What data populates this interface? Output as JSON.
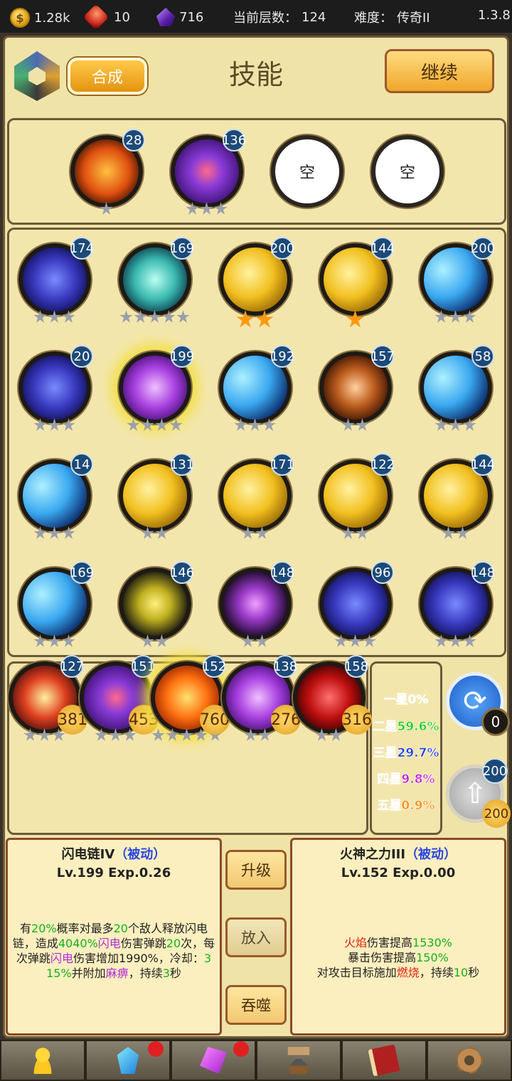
{
  "topbar": {
    "gold": "1.28k",
    "red_gem": "10",
    "crystal": "716",
    "floor_label": "当前层数：",
    "floor": "124",
    "difficulty_label": "难度：",
    "difficulty": "传奇II",
    "version": "1.3.8"
  },
  "header": {
    "merge": "合成",
    "title": "技能",
    "continue": "继续"
  },
  "equipped": [
    {
      "level": "28",
      "stars": 1,
      "color": "orange"
    },
    {
      "level": "136",
      "stars": 3,
      "color": "purple"
    },
    {
      "empty": "空"
    },
    {
      "empty": "空"
    }
  ],
  "grid": [
    [
      {
        "level": "174",
        "stars": 3,
        "color": "navy"
      },
      {
        "level": "169",
        "stars": 5,
        "color": "teal"
      },
      {
        "level": "200",
        "stars": 2,
        "gold_stars": true,
        "color": "gold"
      },
      {
        "level": "144",
        "stars": 1,
        "gold_stars": true,
        "color": "gold"
      },
      {
        "level": "200",
        "stars": 3,
        "color": "sky"
      }
    ],
    [
      {
        "level": "20",
        "stars": 3,
        "color": "navy"
      },
      {
        "level": "199",
        "stars": 4,
        "color": "violet",
        "selected": true
      },
      {
        "level": "192",
        "stars": 3,
        "color": "sky"
      },
      {
        "level": "157",
        "stars": 2,
        "color": "brown"
      },
      {
        "level": "58",
        "stars": 3,
        "color": "sky"
      }
    ],
    [
      {
        "level": "14",
        "stars": 3,
        "color": "sky"
      },
      {
        "level": "131",
        "stars": 2,
        "color": "gold"
      },
      {
        "level": "171",
        "stars": 2,
        "color": "gold"
      },
      {
        "level": "122",
        "stars": 2,
        "color": "gold"
      },
      {
        "level": "144",
        "stars": 2,
        "color": "gold"
      }
    ],
    [
      {
        "level": "169",
        "stars": 3,
        "color": "sky"
      },
      {
        "level": "146",
        "stars": 2,
        "color": "dark-yel"
      },
      {
        "level": "148",
        "stars": 2,
        "color": "dark-pur"
      },
      {
        "level": "96",
        "stars": 3,
        "color": "navy"
      },
      {
        "level": "148",
        "stars": 3,
        "color": "navy"
      }
    ]
  ],
  "bag": [
    {
      "level": "127",
      "count": "381",
      "stars": 3,
      "color": "red"
    },
    {
      "level": "151",
      "count": "453",
      "stars": 3,
      "color": "purple"
    },
    {
      "level": "152",
      "count": "760",
      "stars": 5,
      "color": "fire",
      "selected": true
    },
    {
      "level": "138",
      "count": "276",
      "stars": 2,
      "color": "violet"
    },
    {
      "level": "158",
      "count": "316",
      "stars": 2,
      "color": "crimson"
    }
  ],
  "rates": [
    {
      "label": "一星0%",
      "color": "#ffffff"
    },
    {
      "label": "二星59.6%",
      "color": "#18d018"
    },
    {
      "label": "三星29.7%",
      "color": "#1a3ae8"
    },
    {
      "label": "四星9.8%",
      "color": "#c020e0"
    },
    {
      "label": "五星0.9%",
      "color": "#ff8a10"
    }
  ],
  "refresh_count": "0",
  "upgrade": {
    "level": "200",
    "cost": "200"
  },
  "left_info": {
    "name": "闪电链IV",
    "type": "（被动）",
    "level_line": "Lv.199 Exp.0.26",
    "t1": "有",
    "v1": "20%",
    "t2": "概率对最多",
    "v2": "20",
    "t3": "个敌人释放闪电链，造成",
    "v3": "4040%",
    "t4": "闪电",
    "t5": "伤害弹跳",
    "v4": "20",
    "t6": "次，每次弹跳",
    "t7": "闪电",
    "t8": "伤害增加1990%，冷却：",
    "v5": "3",
    "v6": "15%",
    "t9": "并附加",
    "t10": "麻痹",
    "t11": "，持续",
    "v7": "3",
    "t12": "秒"
  },
  "right_info": {
    "name": "火神之力III",
    "type": "（被动）",
    "level_line": "Lv.152 Exp.0.00",
    "l1a": "火焰",
    "l1b": "伤害提高",
    "l1c": "1530%",
    "l2a": "暴击伤害提高",
    "l2b": "150%",
    "l3a": "对攻击目标施加",
    "l3b": "燃烧",
    "l3c": "，持续",
    "l3d": "10",
    "l3e": "秒"
  },
  "actions": {
    "upgrade": "升级",
    "put": "放入",
    "devour": "吞噬"
  },
  "nav": [
    "hero-icon",
    "crystal-icon",
    "gem-icon",
    "anvil-icon",
    "book-icon",
    "gear-icon"
  ]
}
